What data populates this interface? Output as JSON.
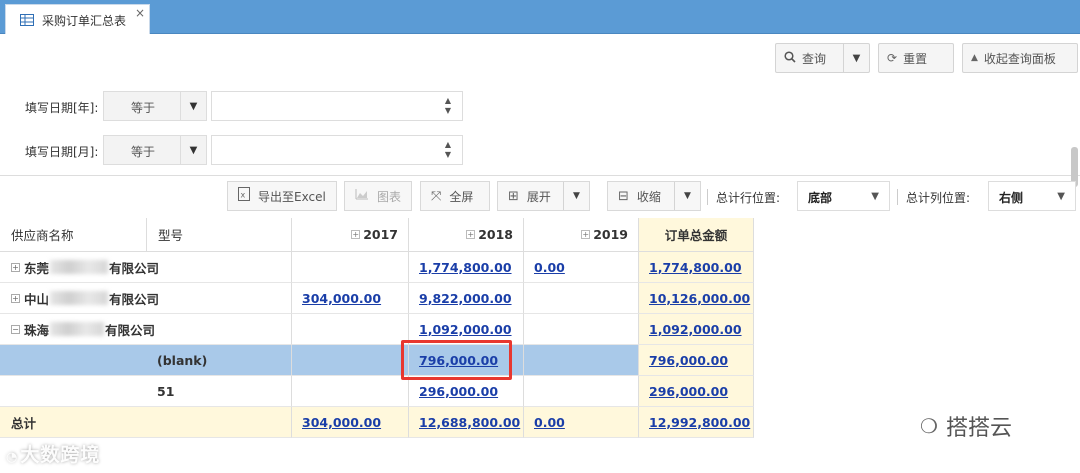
{
  "tab": {
    "label": "采购订单汇总表",
    "close": "×",
    "icon": "table-grid-icon"
  },
  "actions": {
    "query": "查询",
    "reset": "重置",
    "collapse_panel": "收起查询面板"
  },
  "filters": [
    {
      "label": "填写日期[年]:",
      "operator": "等于",
      "value": ""
    },
    {
      "label": "填写日期[月]:",
      "operator": "等于",
      "value": ""
    }
  ],
  "toolbar": {
    "export": "导出至Excel",
    "chart": "图表",
    "fullscreen": "全屏",
    "expand": "展开",
    "collapse": "收缩",
    "row_total_label": "总计行位置:",
    "row_total_value": "底部",
    "col_total_label": "总计列位置:",
    "col_total_value": "右侧"
  },
  "table": {
    "headers": {
      "supplier": "供应商名称",
      "model": "型号",
      "y2017": "2017",
      "y2018": "2018",
      "y2019": "2019",
      "total": "订单总金额"
    },
    "rows": [
      {
        "supplier_prefix": "东莞",
        "supplier_suffix": "有限公司",
        "model": "",
        "y2017": "",
        "y2018": "1,774,800.00",
        "y2019": "0.00",
        "total": "1,774,800.00",
        "tree": "⊞"
      },
      {
        "supplier_prefix": "中山",
        "supplier_suffix": "有限公司",
        "model": "",
        "y2017": "304,000.00",
        "y2018": "9,822,000.00",
        "y2019": "",
        "total": "10,126,000.00",
        "tree": "⊞"
      },
      {
        "supplier_prefix": "珠海",
        "supplier_suffix": "有限公司",
        "model": "",
        "y2017": "",
        "y2018": "1,092,000.00",
        "y2019": "",
        "total": "1,092,000.00",
        "tree": "⊟"
      },
      {
        "supplier_prefix": "",
        "supplier_suffix": "",
        "model": "(blank)",
        "y2017": "",
        "y2018": "796,000.00",
        "y2019": "",
        "total": "796,000.00",
        "tree": ""
      },
      {
        "supplier_prefix": "",
        "supplier_suffix": "",
        "model": "51",
        "y2017": "",
        "y2018": "296,000.00",
        "y2019": "",
        "total": "296,000.00",
        "tree": ""
      }
    ],
    "grand_total": {
      "label": "总计",
      "y2017": "304,000.00",
      "y2018": "12,688,800.00",
      "y2019": "0.00",
      "total": "12,992,800.00"
    }
  },
  "watermarks": {
    "left": "大数跨境",
    "right": "搭搭云"
  },
  "colors": {
    "tab_bar": "#5b9bd5",
    "selected_row": "#a9c9e9",
    "total_column": "#fff8dc",
    "link": "#1a3ea8",
    "highlight": "#e8372f"
  }
}
